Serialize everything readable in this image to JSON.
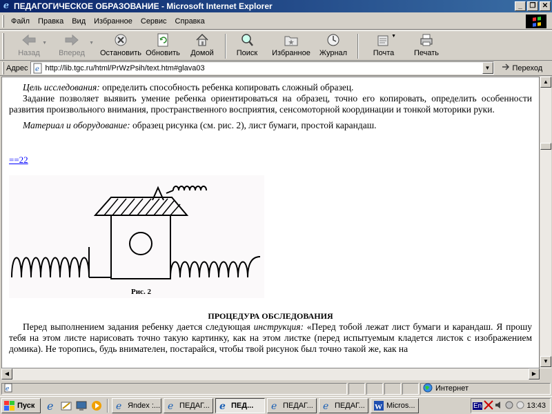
{
  "window": {
    "title": "ПЕДАГОГИЧЕСКОЕ ОБРАЗОВАНИЕ - Microsoft Internet Explorer",
    "min_glyph": "_",
    "max_glyph": "❐",
    "close_glyph": "✕"
  },
  "menu": [
    {
      "label": "Файл"
    },
    {
      "label": "Правка"
    },
    {
      "label": "Вид"
    },
    {
      "label": "Избранное"
    },
    {
      "label": "Сервис"
    },
    {
      "label": "Справка"
    }
  ],
  "toolbar": {
    "back": "Назад",
    "forward": "Вперед",
    "stop": "Остановить",
    "refresh": "Обновить",
    "home": "Домой",
    "search": "Поиск",
    "favorites": "Избранное",
    "history": "Журнал",
    "mail": "Почта",
    "print": "Печать"
  },
  "address": {
    "label": "Адрес",
    "url": "http://lib.tgc.ru/html/PrWzPsih/text.htm#glava03",
    "go": "Переход"
  },
  "content": {
    "p1_italic": "Цель исследования:",
    "p1_text": " определить способность ребенка копировать сложный образец.",
    "p2": "Задание позволяет выявить умение ребенка ориентироваться на образец, точно его копировать, определить особенности развития произвольного внимания, пространственного восприятия, сенсомоторной координации и тонкой моторики руки.",
    "p3_italic": "Материал и оборудование:",
    "p3_text": " образец рисунка (см. рис. 2), лист бумаги, простой карандаш.",
    "anchor": "==22",
    "figure_caption": "Рис. 2",
    "heading": "ПРОЦЕДУРА ОБСЛЕДОВАНИЯ",
    "p4_a": "Перед выполнением задания ребенку дается следующая ",
    "p4_italic": "инструкция:",
    "p4_b": " «Перед тобой лежат лист бумаги и карандаш. Я прошу тебя на этом листе нарисовать точно такую картинку, как на этом листке (перед испытуемым кладется листок с изображением домика). Не торопись, будь внимателен, постарайся, чтобы твой рисунок был точно такой же, как на"
  },
  "status": {
    "zone": "Интернет"
  },
  "taskbar": {
    "start": "Пуск",
    "tasks": [
      {
        "label": "Яndex :..."
      },
      {
        "label": "ПЕДАГ..."
      },
      {
        "label": "ПЕД..."
      },
      {
        "label": "ПЕДАГ..."
      },
      {
        "label": "ПЕДАГ..."
      },
      {
        "label": "Micros..."
      }
    ],
    "lang": "En",
    "clock": "13:43"
  }
}
